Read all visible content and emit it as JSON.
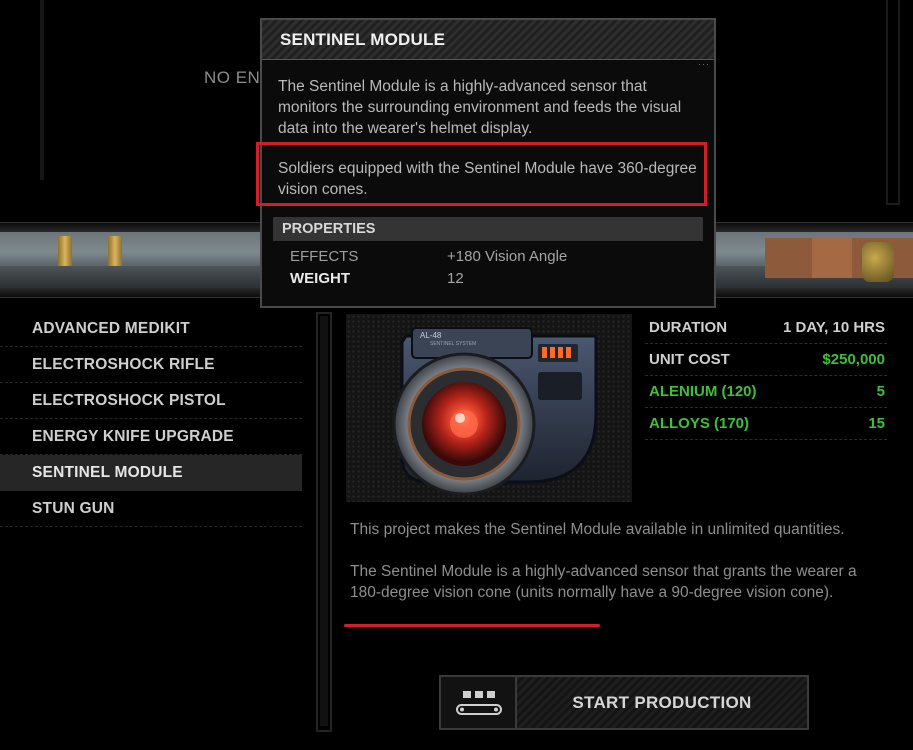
{
  "top": {
    "banner_text": "NO EN"
  },
  "tooltip": {
    "title": "SENTINEL MODULE",
    "description": "The Sentinel Module is a highly-advanced sensor that monitors the surrounding environment and feeds the visual data into the wearer's helmet display.",
    "highlight": "Soldiers equipped with the Sentinel Module have 360-degree vision cones.",
    "properties_header": "PROPERTIES",
    "properties": [
      {
        "key": "EFFECTS",
        "value": "+180 Vision Angle"
      },
      {
        "key": "WEIGHT",
        "value": "12"
      }
    ]
  },
  "items": [
    {
      "label": "ADVANCED MEDIKIT"
    },
    {
      "label": "ELECTROSHOCK RIFLE"
    },
    {
      "label": "ELECTROSHOCK PISTOL"
    },
    {
      "label": "ENERGY KNIFE UPGRADE"
    },
    {
      "label": "SENTINEL MODULE",
      "selected": true
    },
    {
      "label": "STUN GUN"
    }
  ],
  "image": {
    "label_top": "AL-48",
    "label_sub": "SENTINEL SYSTEM"
  },
  "stats": [
    {
      "label": "DURATION",
      "value": "1 DAY, 10 HRS"
    },
    {
      "label": "UNIT COST",
      "value": "$250,000",
      "value_color": "#3fbf3b"
    },
    {
      "label": "ALENIUM (120)",
      "value": "5",
      "label_color": "#3fbf3b",
      "value_color": "#3fbf3b"
    },
    {
      "label": "ALLOYS (170)",
      "value": "15",
      "label_color": "#3fbf3b",
      "value_color": "#3fbf3b"
    }
  ],
  "description": {
    "para1": "This project makes the Sentinel Module available in unlimited quantities.",
    "para2": "The Sentinel Module is a highly-advanced sensor that grants the wearer a 180-degree vision cone (units normally have a 90-degree vision cone)."
  },
  "start_button": {
    "label": "START PRODUCTION",
    "icon": "production-icon"
  },
  "colors": {
    "accent_green": "#3fbf3b",
    "highlight_red": "#d11f2a"
  }
}
